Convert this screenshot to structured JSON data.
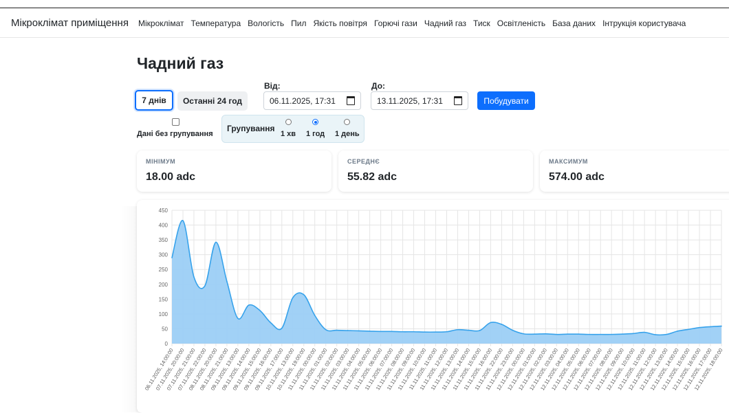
{
  "navbar": {
    "brand": "Мікроклімат приміщення",
    "items": [
      "Мікроклімат",
      "Температура",
      "Вологість",
      "Пил",
      "Якість повітря",
      "Горючі гази",
      "Чадний газ",
      "Тиск",
      "Освітленість",
      "База даних",
      "Інтрукція користувача"
    ]
  },
  "page": {
    "title": "Чадний газ"
  },
  "range": {
    "days7": "7 днів",
    "last24": "Останні 24 год"
  },
  "from": {
    "label": "Від:",
    "value": "06.11.2025, 17:31"
  },
  "to": {
    "label": "До:",
    "value": "13.11.2025, 17:31"
  },
  "build_label": "Побудувати",
  "nogroup_label": "Дані без групування",
  "grouping": {
    "label": "Групування",
    "options": [
      "1 хв",
      "1 год",
      "1 день"
    ],
    "selected": "1 год"
  },
  "stats": {
    "min_label": "МІНІМУМ",
    "min_value": "18.00 adc",
    "avg_label": "СЕРЕДНЄ",
    "avg_value": "55.82 adc",
    "max_label": "МАКСИМУМ",
    "max_value": "574.00 adc"
  },
  "colors": {
    "primary": "#0d6efd",
    "line": "#36a2eb",
    "fill": "#9ccff5"
  },
  "chart_data": {
    "type": "area",
    "ylim": [
      0,
      450
    ],
    "yticks": [
      0,
      50,
      100,
      150,
      200,
      250,
      300,
      350,
      400,
      450
    ],
    "grid": true,
    "x": [
      "06.11.2025, 14:00:00",
      "07.11.2025, 20:00:00",
      "07.11.2025, 21:00:00",
      "07.11.2025, 22:00:00",
      "08.11.2025, 20:00:00",
      "08.11.2025, 21:00:00",
      "09.11.2025, 13:00:00",
      "09.11.2025, 14:00:00",
      "09.11.2025, 15:00:00",
      "09.11.2025, 16:00:00",
      "09.11.2025, 17:00:00",
      "10.11.2025, 13:00:00",
      "10.11.2025, 19:00:00",
      "11.11.2025, 00:00:00",
      "11.11.2025, 01:00:00",
      "11.11.2025, 02:00:00",
      "11.11.2025, 03:00:00",
      "11.11.2025, 04:00:00",
      "11.11.2025, 05:00:00",
      "11.11.2025, 06:00:00",
      "11.11.2025, 07:00:00",
      "11.11.2025, 08:00:00",
      "11.11.2025, 09:00:00",
      "11.11.2025, 10:00:00",
      "11.11.2025, 11:00:00",
      "11.11.2025, 12:00:00",
      "11.11.2025, 13:00:00",
      "11.11.2025, 14:00:00",
      "11.11.2025, 15:00:00",
      "11.11.2025, 16:00:00",
      "11.11.2025, 22:00:00",
      "11.11.2025, 23:00:00",
      "12.11.2025, 00:00:00",
      "12.11.2025, 01:00:00",
      "12.11.2025, 02:00:00",
      "12.11.2025, 03:00:00",
      "12.11.2025, 04:00:00",
      "12.11.2025, 05:00:00",
      "12.11.2025, 06:00:00",
      "12.11.2025, 07:00:00",
      "12.11.2025, 08:00:00",
      "12.11.2025, 09:00:00",
      "12.11.2025, 10:00:00",
      "12.11.2025, 11:00:00",
      "12.11.2025, 12:00:00",
      "12.11.2025, 13:00:00",
      "12.11.2025, 14:00:00",
      "12.11.2025, 15:00:00",
      "12.11.2025, 16:00:00",
      "12.11.2025, 17:00:00",
      "12.11.2025, 18:00:00"
    ],
    "values": [
      290,
      415,
      225,
      195,
      342,
      210,
      85,
      130,
      112,
      70,
      52,
      155,
      165,
      95,
      47,
      45,
      44,
      43,
      42,
      41,
      41,
      40,
      40,
      39,
      39,
      40,
      47,
      45,
      44,
      71,
      65,
      45,
      33,
      32,
      33,
      31,
      32,
      32,
      31,
      31,
      31,
      32,
      34,
      38,
      30,
      31,
      42,
      48,
      54,
      57,
      59
    ]
  }
}
